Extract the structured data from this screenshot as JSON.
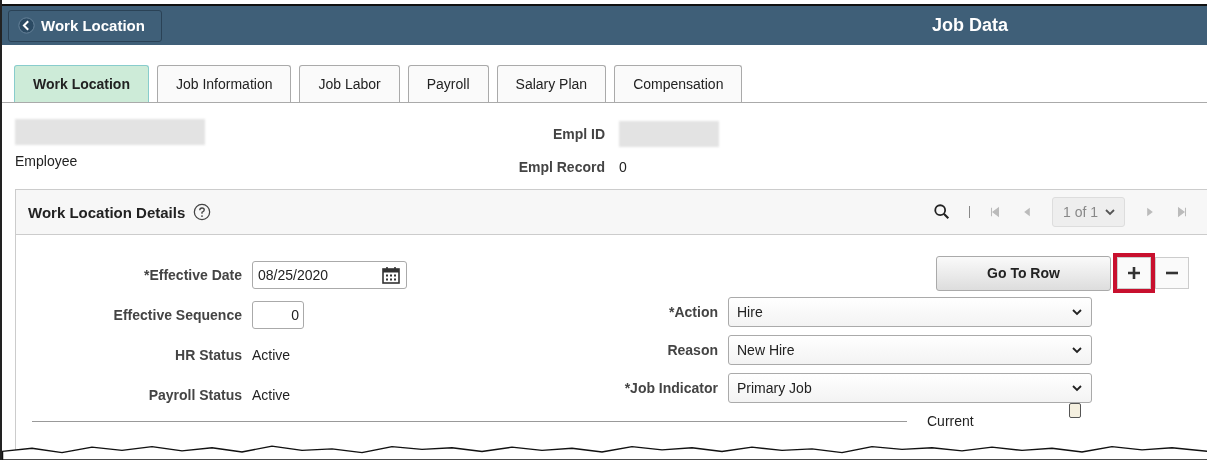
{
  "header": {
    "back_button": "Work Location",
    "title": "Job Data"
  },
  "tabs": [
    {
      "label": "Work Location",
      "selected": true
    },
    {
      "label": "Job Information",
      "selected": false
    },
    {
      "label": "Job Labor",
      "selected": false
    },
    {
      "label": "Payroll",
      "selected": false
    },
    {
      "label": "Salary Plan",
      "selected": false
    },
    {
      "label": "Compensation",
      "selected": false
    }
  ],
  "employee": {
    "name_label": "Employee",
    "empl_id_label": "Empl ID",
    "empl_record_label": "Empl Record",
    "empl_record": "0"
  },
  "panel": {
    "title": "Work Location Details",
    "pager": "1 of 1",
    "go_to_row": "Go To Row",
    "add_highlighted": true
  },
  "left_fields": [
    {
      "kind": "date",
      "label": "*Effective Date",
      "value": "08/25/2020"
    },
    {
      "kind": "number",
      "label": "Effective Sequence",
      "value": "0"
    },
    {
      "kind": "text",
      "label": "HR Status",
      "value": "Active"
    },
    {
      "kind": "text",
      "label": "Payroll Status",
      "value": "Active"
    }
  ],
  "right_fields": [
    {
      "label": "*Action",
      "value": "Hire"
    },
    {
      "label": "Reason",
      "value": "New Hire"
    },
    {
      "label": "*Job Indicator",
      "value": "Primary Job"
    }
  ],
  "current": {
    "label": "Current",
    "checked": false
  }
}
